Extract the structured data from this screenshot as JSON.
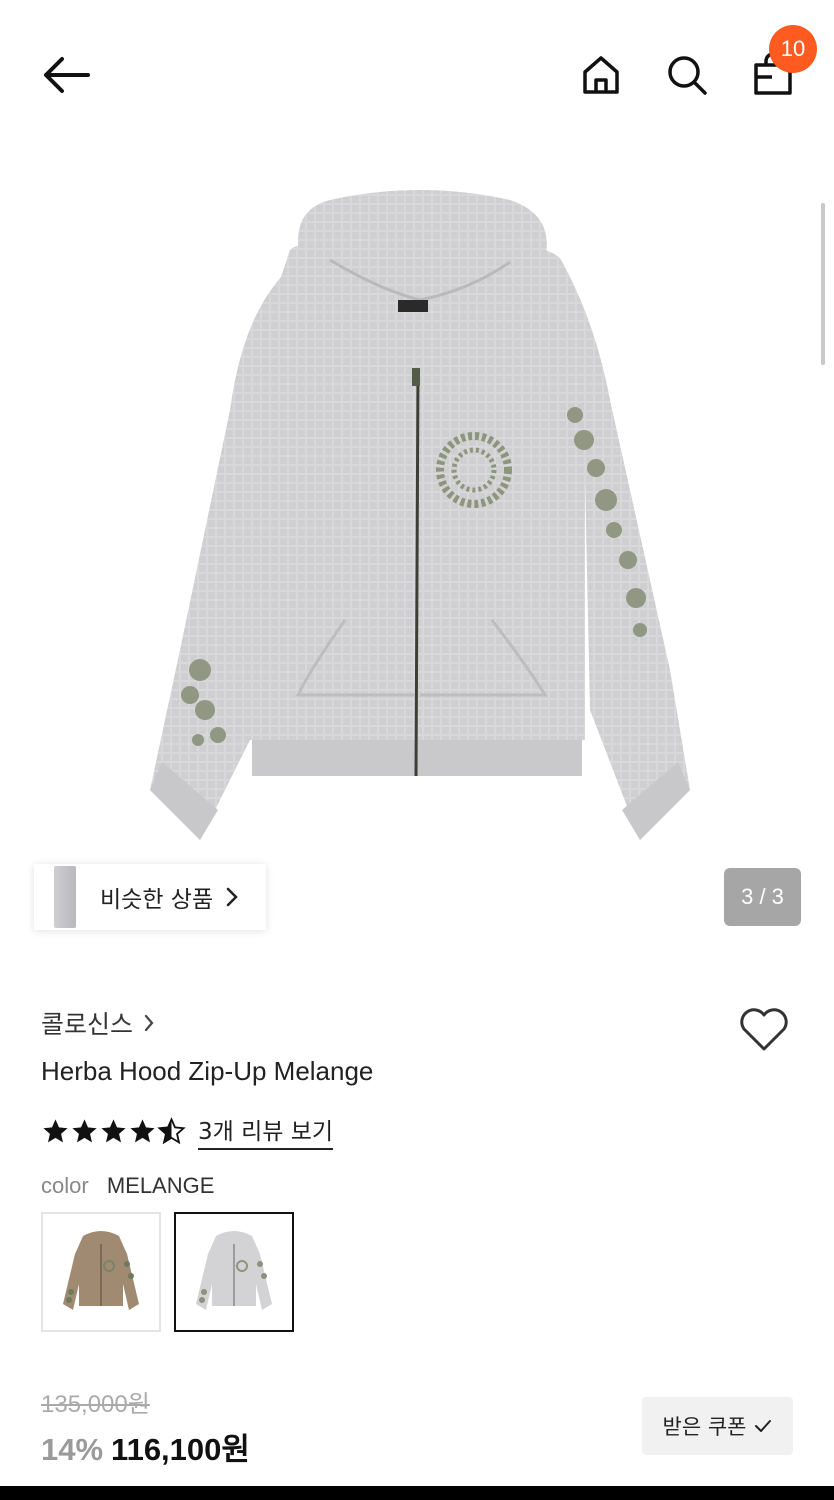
{
  "header": {
    "back_icon": "arrow-left-icon",
    "home_icon": "home-icon",
    "search_icon": "search-icon",
    "cart_icon": "shopping-bag-icon",
    "cart_count": "10",
    "badge_color": "#ff5a1f"
  },
  "gallery": {
    "image": "grey-waffle-zip-hoodie",
    "page_indicator": "3 / 3",
    "similar_label": "비슷한 상품"
  },
  "product": {
    "brand": "콜로신스",
    "name": "Herba Hood Zip-Up Melange",
    "rating": 4.5,
    "review_link": "3개 리뷰 보기",
    "color_label": "color",
    "color_value": "MELANGE",
    "swatches": [
      {
        "name": "beige",
        "color": "#a08a72"
      },
      {
        "name": "melange",
        "color": "#d3d3d5",
        "selected": true
      }
    ]
  },
  "price": {
    "original": "135,000원",
    "discount": "14%",
    "final": "116,100원",
    "coupon_label": "받은 쿠폰"
  }
}
